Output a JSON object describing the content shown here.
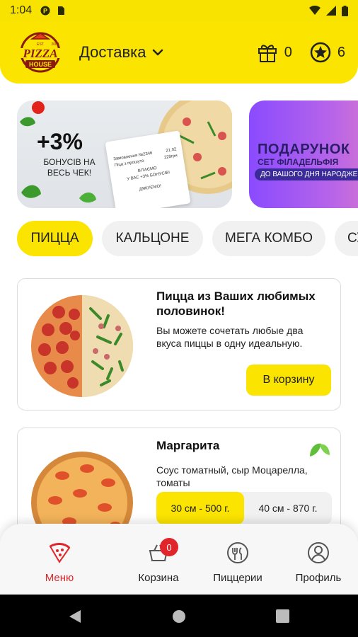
{
  "status_bar": {
    "time": "1:04"
  },
  "header": {
    "logo": {
      "top": "PIZZA",
      "bottom": "HOUSE",
      "est": "EST",
      "year": "2008"
    },
    "delivery_label": "Доставка",
    "bonus_count": "0",
    "stars_count": "6"
  },
  "banners": [
    {
      "headline": "+3%",
      "sub": "БОНУСІВ НА ВЕСЬ ЧЕК!",
      "receipt_lines": [
        "Замовлення №2346",
        "Піца з прошуто",
        "ВІТАЄМО",
        "У ВАС +3% БОНУСІВ!",
        "ДЯКУЄМО!"
      ],
      "receipt_date": "21.02",
      "receipt_price": "229грн"
    },
    {
      "title": "ПОДАРУНОК",
      "sub": "СЕТ ФІЛАДЕЛЬФІЯ",
      "pill": "ДО ВАШОГО ДНЯ НАРОДЖЕННЯ"
    }
  ],
  "categories": [
    "ПИЦЦА",
    "КАЛЬЦОНЕ",
    "МЕГА КОМБО",
    "СУ"
  ],
  "products": [
    {
      "title": "Пицца из Ваших любимых половинок!",
      "description": "Вы можете сочетать любые два вкуса пиццы в одну идеальную.",
      "button": "В корзину"
    },
    {
      "title": "Маргарита",
      "description": "Соус томатный, сыр Моцарелла, томаты",
      "sizes": [
        "30 см - 500 г.",
        "40 см - 870 г."
      ]
    }
  ],
  "bottom_nav": {
    "items": [
      {
        "label": "Меню",
        "icon": "pizza-slice-icon"
      },
      {
        "label": "Корзина",
        "icon": "basket-icon"
      },
      {
        "label": "Пиццерии",
        "icon": "pizzeria-icon"
      },
      {
        "label": "Профиль",
        "icon": "user-icon"
      }
    ],
    "cart_badge": "0"
  },
  "colors": {
    "accent": "#fbe400",
    "active": "#e0262a",
    "banner2": "#8a4bff"
  }
}
